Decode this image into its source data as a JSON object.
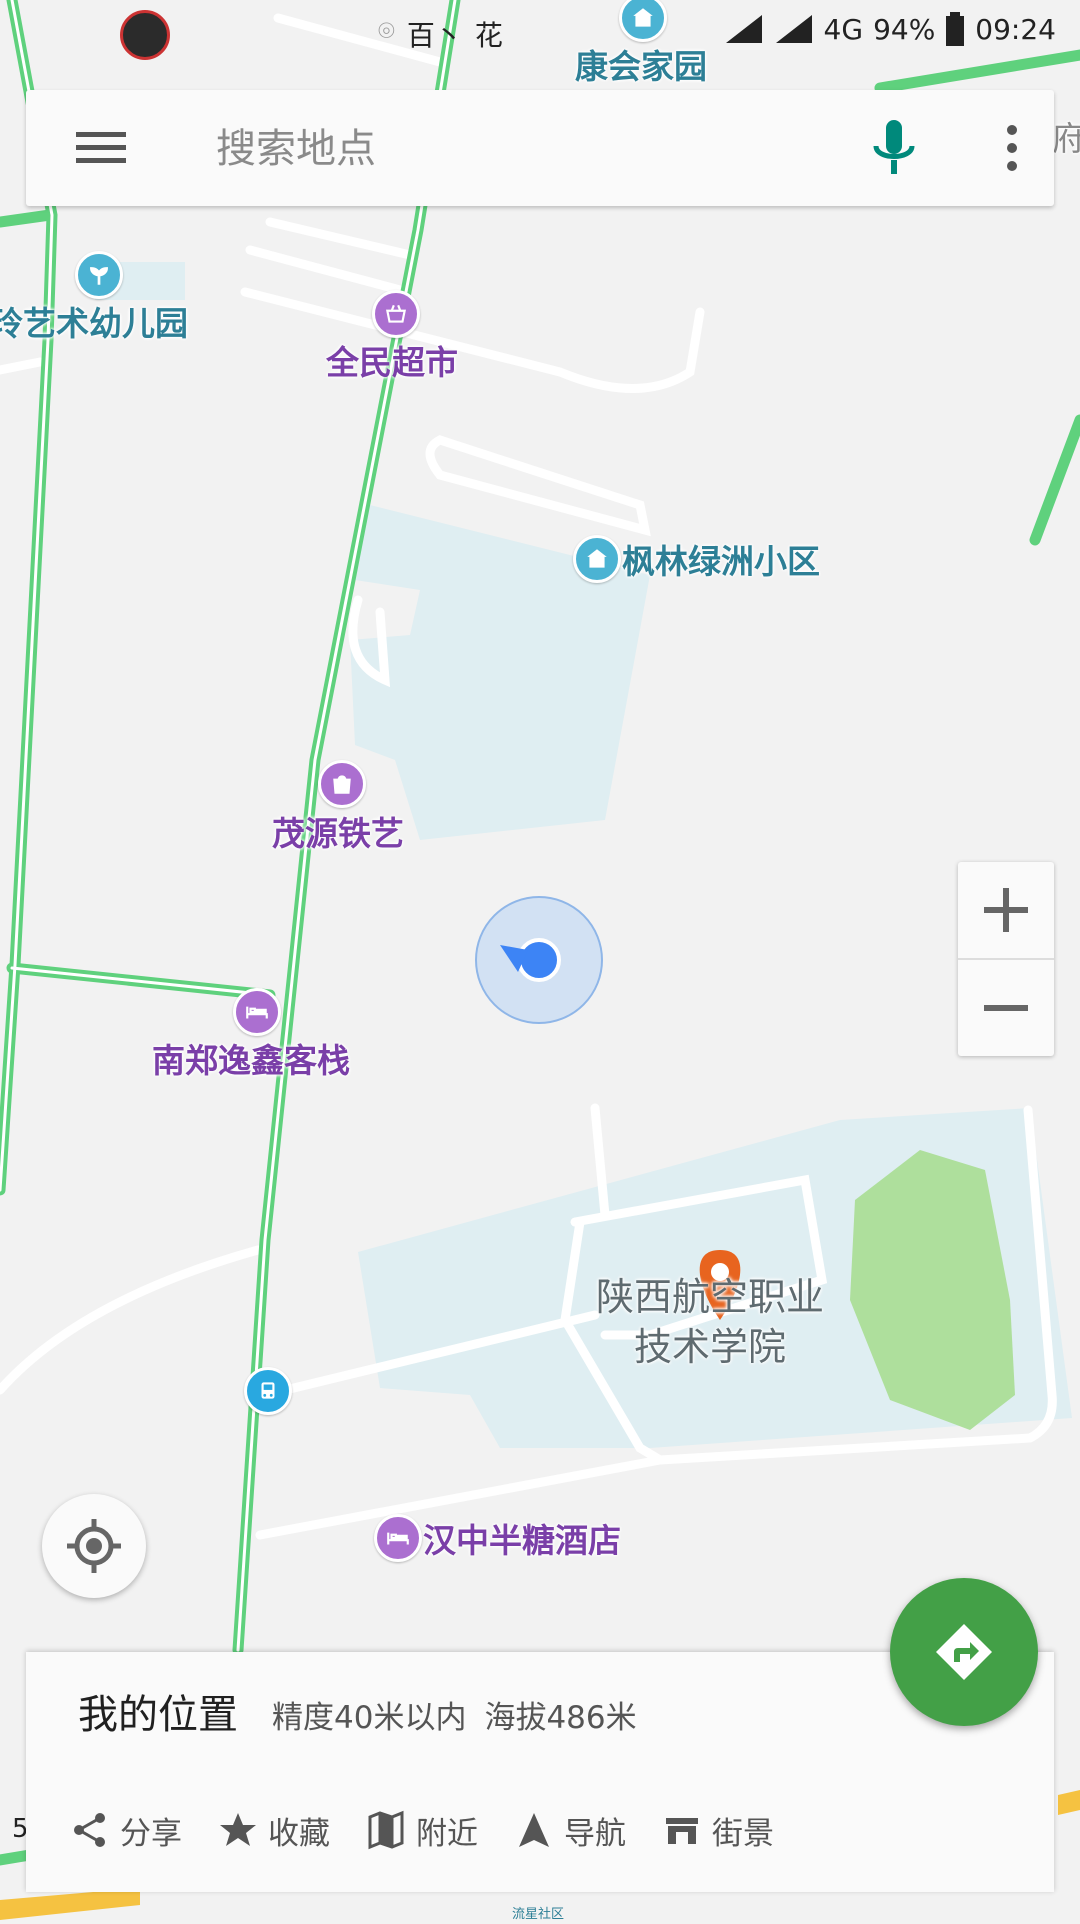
{
  "status_bar": {
    "center_text_1": "百丶",
    "center_text_2": "花",
    "network": "4G",
    "battery": "94%",
    "time": "09:24"
  },
  "search": {
    "placeholder": "搜索地点"
  },
  "map": {
    "pois": {
      "kanghui": "康会家园",
      "kindergarten": "<span>玲艺术幼儿园",
      "supermarket": "全民超市",
      "fenglin": "枫林绿洲小区",
      "maoyuan": "茂源铁艺",
      "inn": "南郑逸鑫客栈",
      "college_line1": "陕西航空职业",
      "college_line2": "技术学院",
      "hotel": "汉中半糖酒店",
      "edge_right": "府",
      "community": "流星社区"
    },
    "scale_text": "5"
  },
  "zoom": {
    "in": "+",
    "out": "−"
  },
  "sheet": {
    "title": "我的位置",
    "accuracy": "精度40米以内",
    "altitude": "海拔486米",
    "actions": [
      {
        "label": "分享",
        "icon": "share-icon"
      },
      {
        "label": "收藏",
        "icon": "star-icon"
      },
      {
        "label": "附近",
        "icon": "map-icon"
      },
      {
        "label": "导航",
        "icon": "navigation-arrow-icon"
      },
      {
        "label": "街景",
        "icon": "street-view-icon"
      }
    ]
  },
  "colors": {
    "accent_green": "#43a047",
    "mic_teal": "#00897b",
    "location_blue": "#3d84f5",
    "marker_orange": "#e8641f",
    "road_green": "#5fd17d"
  }
}
